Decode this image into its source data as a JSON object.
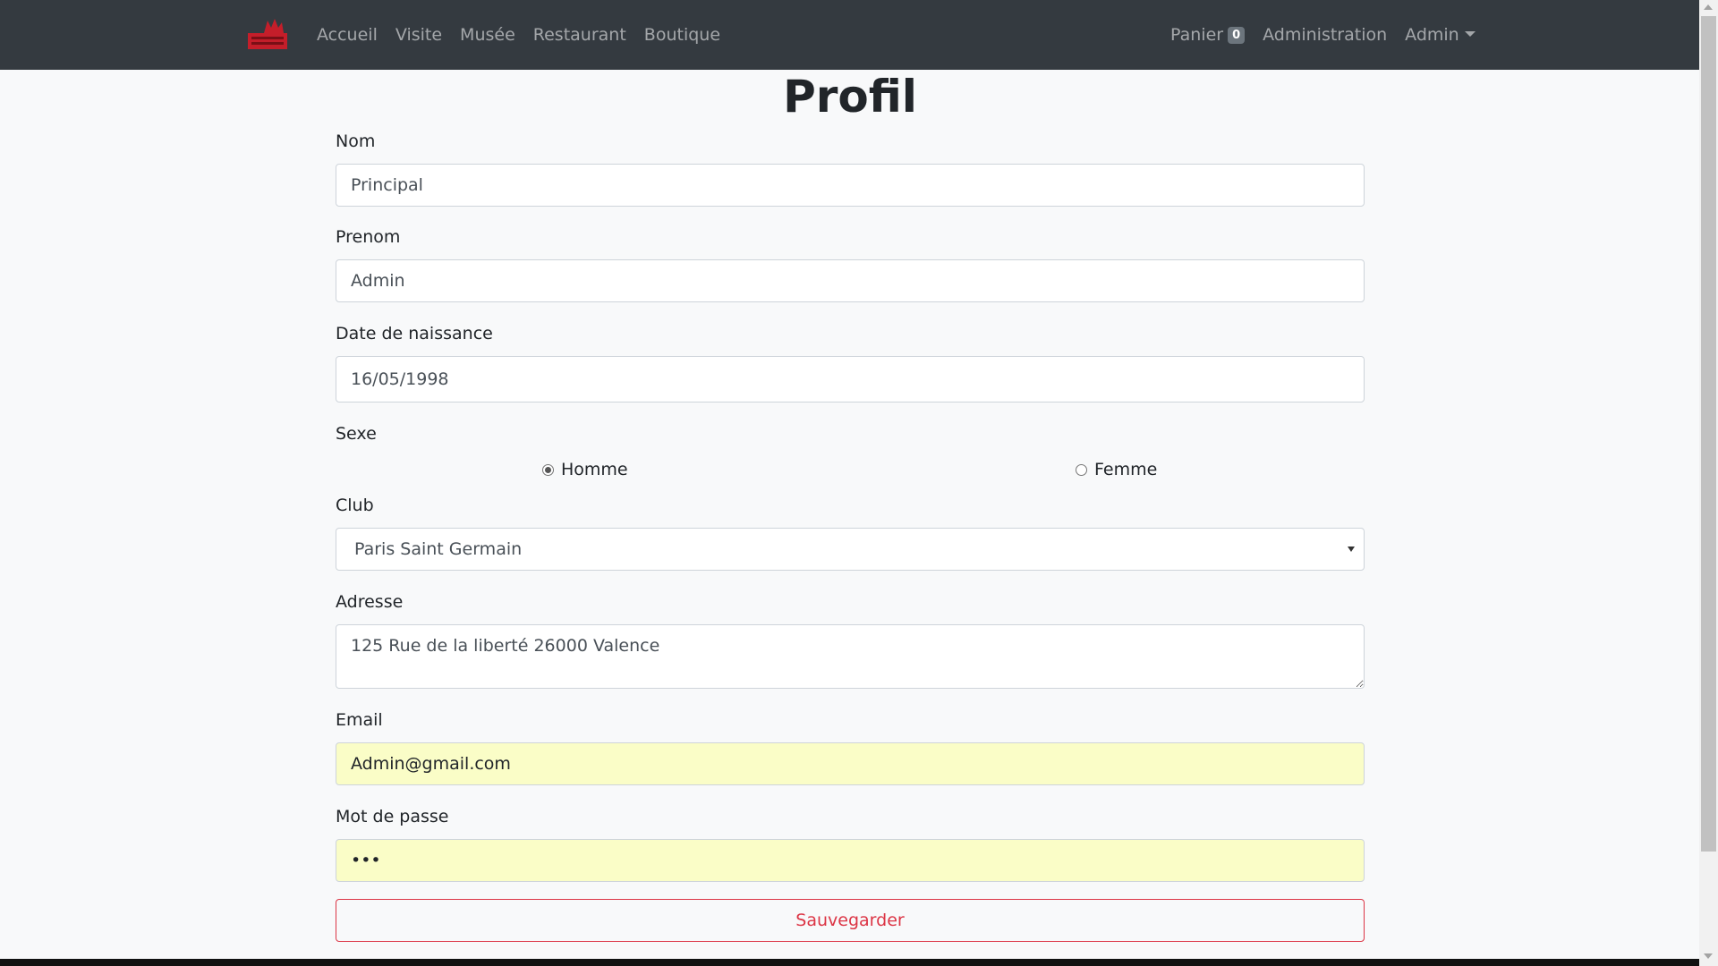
{
  "navbar": {
    "brand_icon": "club-logo",
    "links": [
      "Accueil",
      "Visite",
      "Musée",
      "Restaurant",
      "Boutique"
    ],
    "cart_label": "Panier",
    "cart_count": "0",
    "admin_link": "Administration",
    "user_menu": "Admin"
  },
  "page": {
    "title": "Profil"
  },
  "form": {
    "nom": {
      "label": "Nom",
      "value": "Principal"
    },
    "prenom": {
      "label": "Prenom",
      "value": "Admin"
    },
    "naissance": {
      "label": "Date de naissance",
      "value": "16/05/1998"
    },
    "sexe": {
      "label": "Sexe",
      "options": [
        "Homme",
        "Femme"
      ],
      "selected": "Homme"
    },
    "club": {
      "label": "Club",
      "value": "Paris Saint Germain"
    },
    "adresse": {
      "label": "Adresse",
      "value": "125 Rue de la liberté 26000 Valence"
    },
    "email": {
      "label": "Email",
      "value": "Admin@gmail.com"
    },
    "password": {
      "label": "Mot de passe",
      "value": "•••"
    },
    "submit_label": "Sauvegarder"
  },
  "colors": {
    "navbar_bg": "#343a40",
    "danger": "#dc3545",
    "autofill_bg": "#fafdc7",
    "brand_red": "#c41e2a"
  }
}
